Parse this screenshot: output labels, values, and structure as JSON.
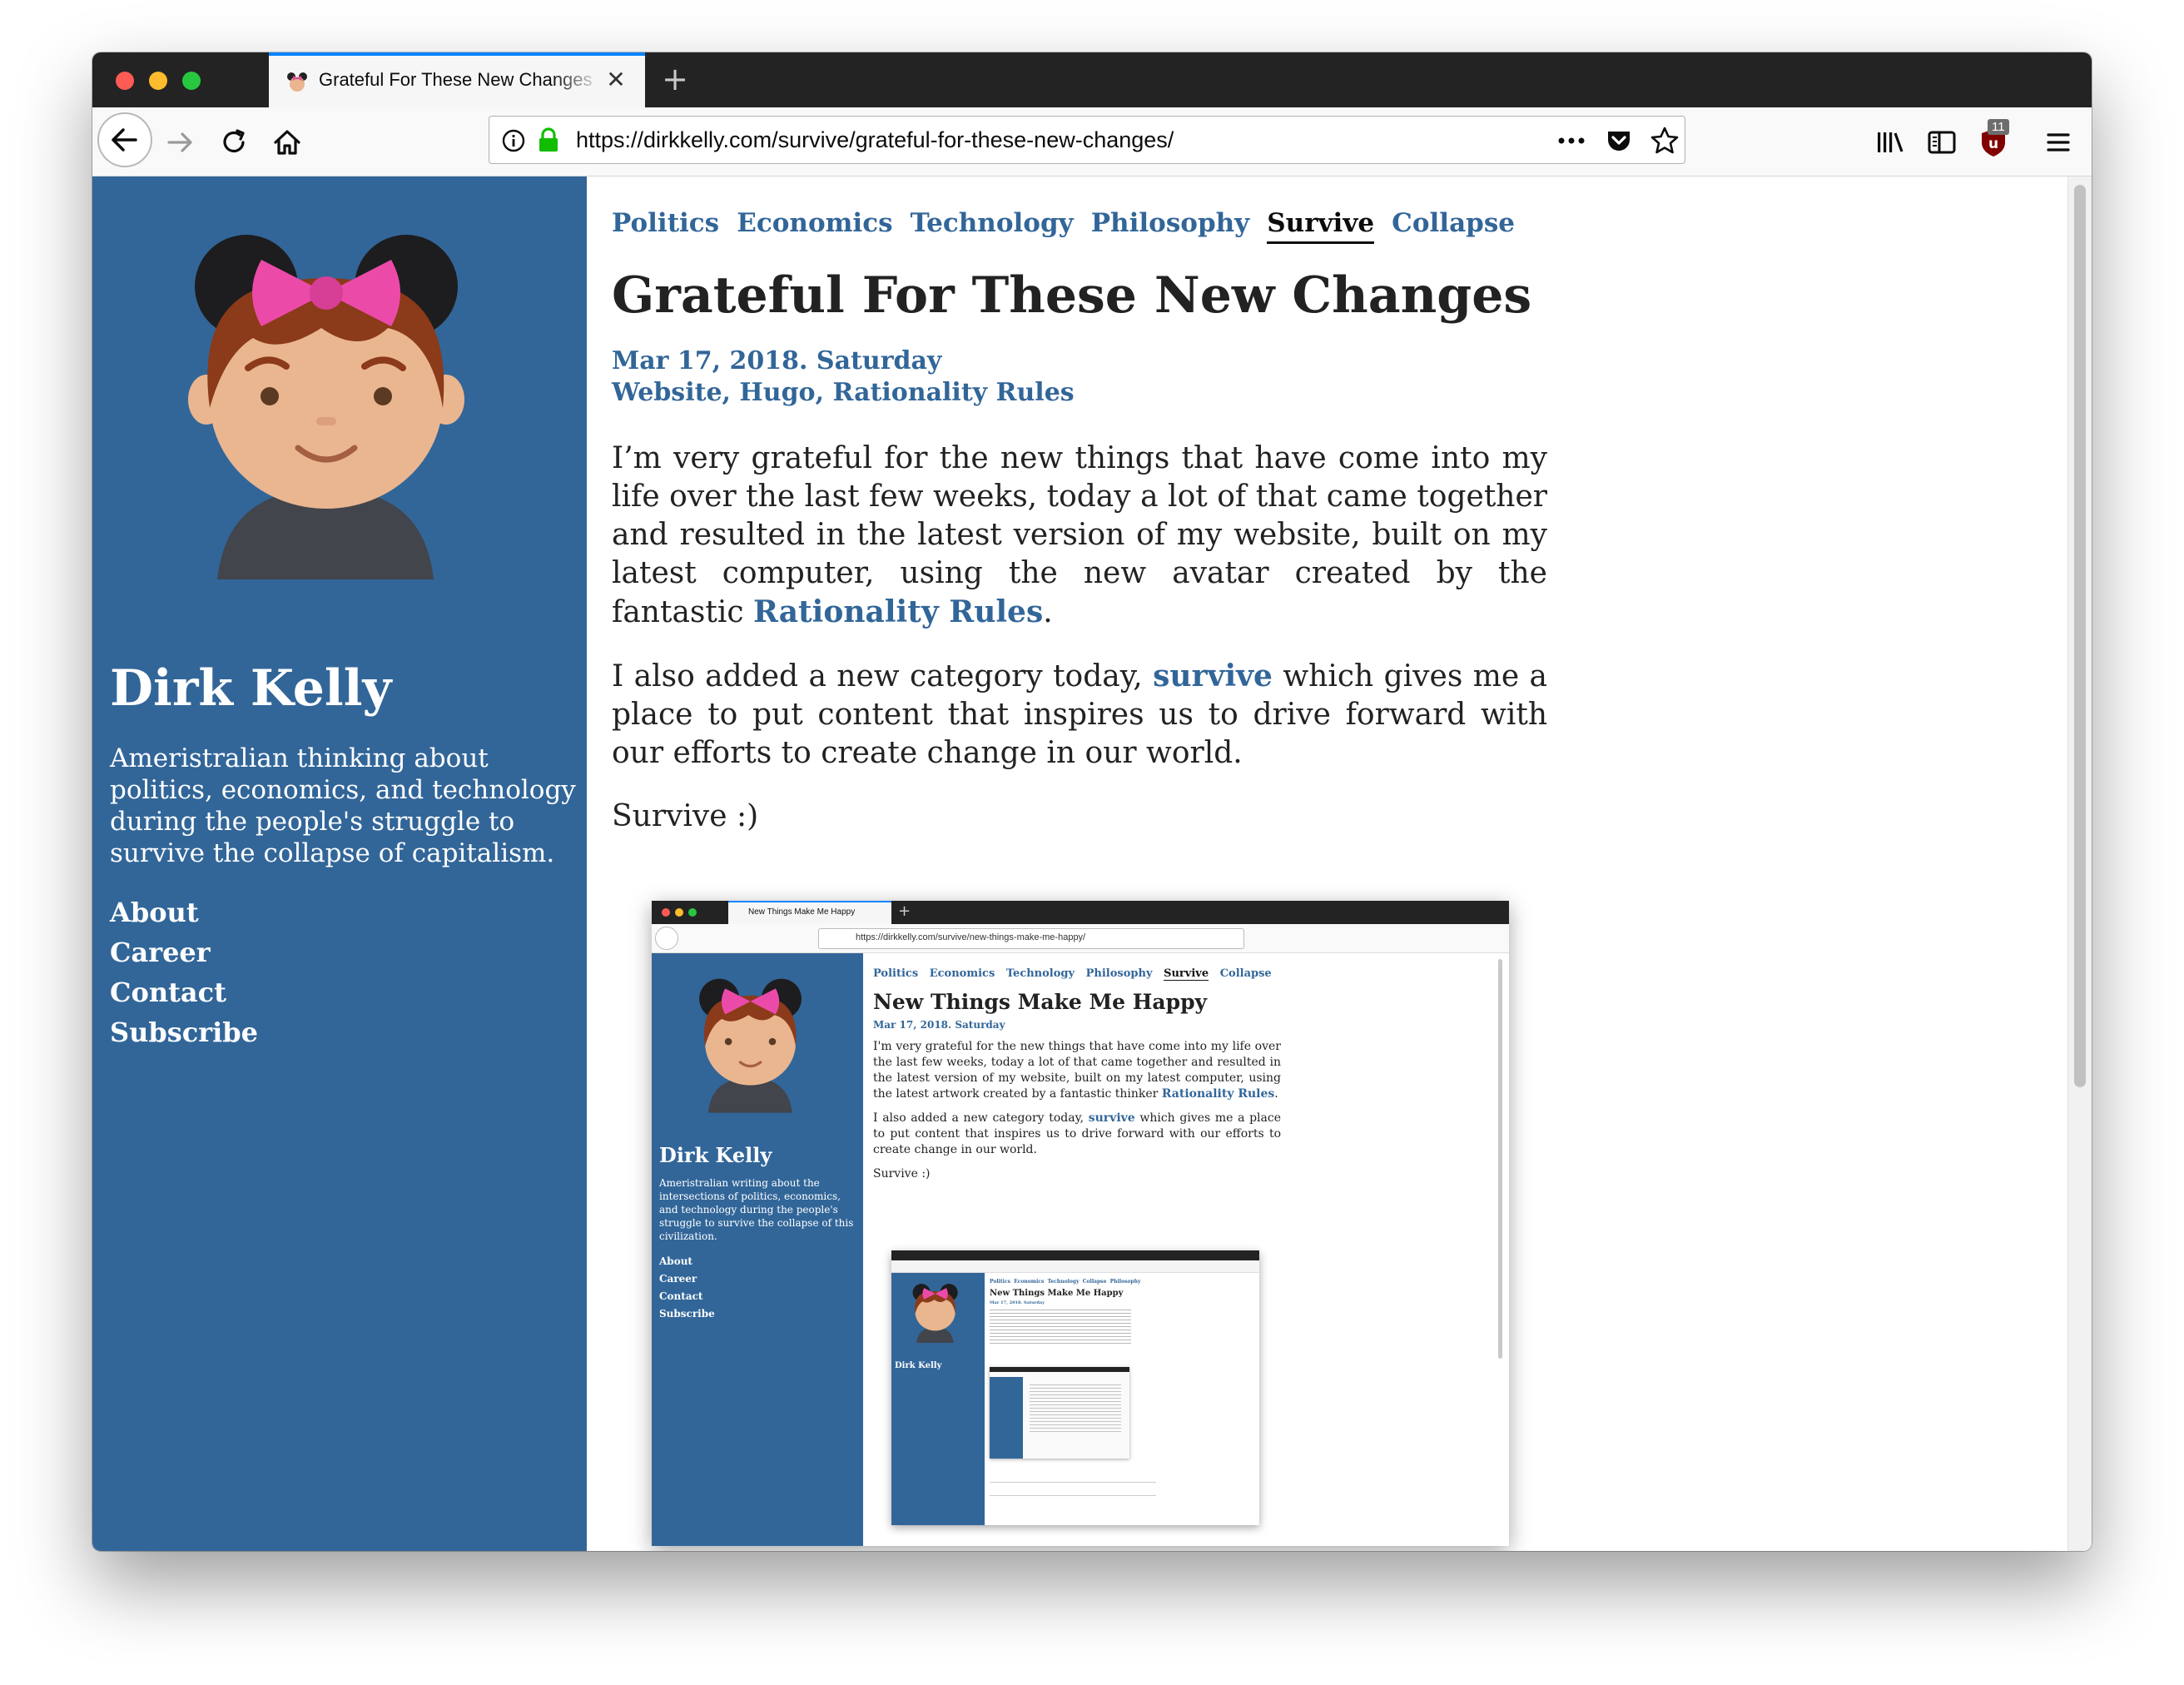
{
  "browser": {
    "tab_title": "Grateful For These New Changes",
    "tab_close": "✕",
    "new_tab": "+",
    "url": "https://dirkkelly.com/survive/grateful-for-these-new-changes/",
    "addon_badge": "11"
  },
  "sidebar": {
    "site_title": "Dirk Kelly",
    "description": "Ameristralian thinking about politics, economics, and technology during the people's struggle to survive the collapse of capitalism.",
    "nav": [
      "About",
      "Career",
      "Contact",
      "Subscribe"
    ]
  },
  "categories": [
    "Politics",
    "Economics",
    "Technology",
    "Philosophy",
    "Survive",
    "Collapse"
  ],
  "active_category": "Survive",
  "post": {
    "title": "Grateful For These New Changes",
    "date": "Mar 17, 2018. Saturday",
    "tags": "Website, Hugo, Rationality Rules",
    "p1_text": "I’m very grateful for the new things that have come into my life over the last few weeks, today a lot of that came together and resulted in the latest version of my website, built on my latest computer, using the new avatar created by the fantastic ",
    "p1_link": "Rationality Rules",
    "p1_end": ".",
    "p2_start": "I also added a new category today, ",
    "p2_link": "survive",
    "p2_end": " which gives me a place to put content that inspires us to drive forward with our efforts to create change in our world.",
    "p3": "Survive :)"
  },
  "embedded_screenshot": {
    "tab_title": "New Things Make Me Happy",
    "url": "https://dirkkelly.com/survive/new-things-make-me-happy/",
    "categories": [
      "Politics",
      "Economics",
      "Technology",
      "Philosophy",
      "Survive",
      "Collapse"
    ],
    "active_category": "Survive",
    "post_title": "New Things Make Me Happy",
    "post_date": "Mar 17, 2018. Saturday",
    "p1_text": "I'm very grateful for the new things that have come into my life over the last few weeks, today a lot of that came together and resulted in the latest version of my website, built on my latest computer, using the latest artwork created by a fantastic thinker ",
    "p1_link": "Rationality Rules",
    "p1_end": ".",
    "p2_start": "I also added a new category today, ",
    "p2_link": "survive",
    "p2_end": " which gives me a place to put content that inspires us to drive forward with our efforts to create change in our world.",
    "p3": "Survive :)",
    "site_title": "Dirk Kelly",
    "description": "Ameristralian writing about the intersections of politics, economics, and technology during the people's struggle to survive the collapse of this civilization.",
    "nav": [
      "About",
      "Career",
      "Contact",
      "Subscribe"
    ],
    "nested_categories": [
      "Politics",
      "Economics",
      "Technology",
      "Collapse",
      "Philosophy"
    ],
    "nested_title": "New Things Make Me Happy",
    "nested_date": "Mar 17, 2018. Saturday",
    "nested_site_title": "Dirk Kelly"
  },
  "colors": {
    "sidebar_blue": "#326699",
    "link_blue": "#326699",
    "tab_accent": "#0a84ff",
    "lock_green": "#12bc00",
    "avatar_bow": "#ec4aa9",
    "avatar_hair": "#8b3a1a",
    "avatar_skin": "#eab690"
  },
  "icons": [
    "back-arrow-icon",
    "forward-arrow-icon",
    "reload-icon",
    "home-icon",
    "info-icon",
    "lock-icon",
    "page-actions-icon",
    "pocket-icon",
    "bookmark-star-icon",
    "library-icon",
    "sidebar-icon",
    "ublock-icon",
    "menu-icon"
  ]
}
